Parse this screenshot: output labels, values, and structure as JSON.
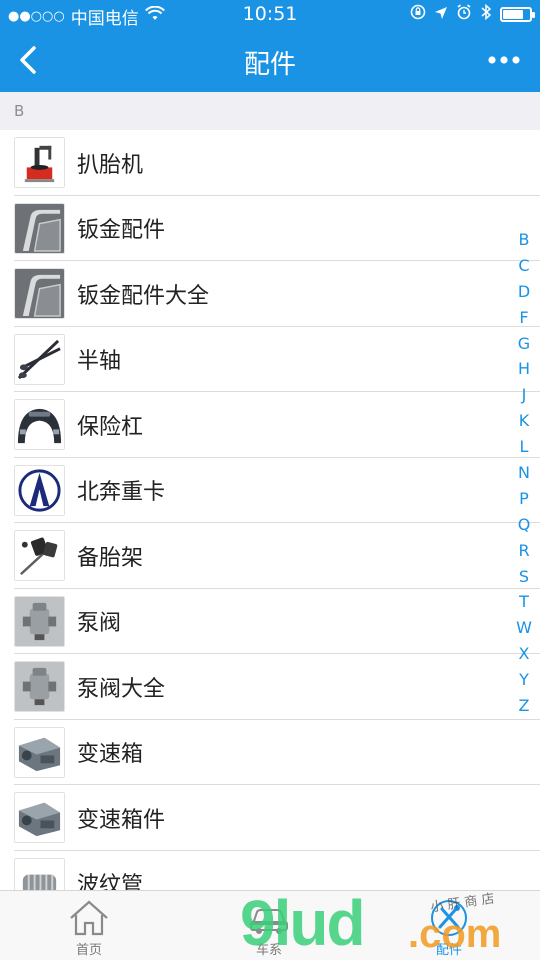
{
  "status_bar": {
    "signal_dots": "●●○○○",
    "carrier": "中国电信",
    "time": "10:51"
  },
  "nav": {
    "back_icon": "chevron-left-icon",
    "title": "配件",
    "more_icon": "more-dots-icon"
  },
  "section_letter": "B",
  "items": [
    {
      "label": "扒胎机",
      "icon": "tire-changer-icon"
    },
    {
      "label": "钣金配件",
      "icon": "sheet-metal-icon"
    },
    {
      "label": "钣金配件大全",
      "icon": "sheet-metal-icon"
    },
    {
      "label": "半轴",
      "icon": "half-shaft-icon"
    },
    {
      "label": "保险杠",
      "icon": "bumper-icon"
    },
    {
      "label": "北奔重卡",
      "icon": "beiben-logo-icon"
    },
    {
      "label": "备胎架",
      "icon": "spare-tire-carrier-icon"
    },
    {
      "label": "泵阀",
      "icon": "pump-valve-icon"
    },
    {
      "label": "泵阀大全",
      "icon": "pump-valve-icon"
    },
    {
      "label": "变速箱",
      "icon": "gearbox-icon"
    },
    {
      "label": "变速箱件",
      "icon": "gearbox-icon"
    },
    {
      "label": "波纹管",
      "icon": "bellows-icon"
    }
  ],
  "index_letters": [
    "B",
    "C",
    "D",
    "F",
    "G",
    "H",
    "J",
    "K",
    "L",
    "N",
    "P",
    "Q",
    "R",
    "S",
    "T",
    "W",
    "X",
    "Y",
    "Z"
  ],
  "tabs": [
    {
      "label": "首页",
      "icon": "home-icon"
    },
    {
      "label": "车系",
      "icon": "car-icon"
    },
    {
      "label": "配件",
      "icon": "tools-icon"
    }
  ],
  "watermark": {
    "text": "9lud",
    "suffix": ".com",
    "tagline": "小 肝 商 店"
  },
  "colors": {
    "accent": "#1a93e5",
    "section_bg": "#efeff4",
    "watermark_green": "#3ad07a",
    "watermark_orange": "#f39a1f"
  }
}
